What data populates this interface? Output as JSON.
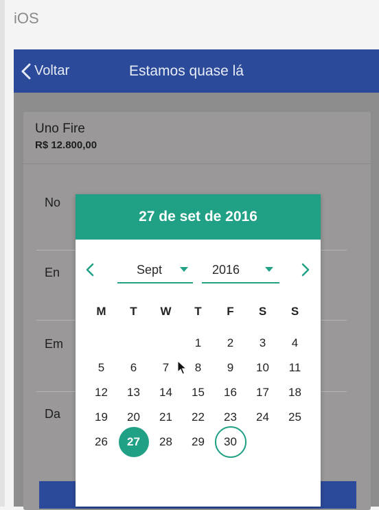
{
  "os_label": "iOS",
  "navbar": {
    "back_label": "Voltar",
    "title": "Estamos quase lá"
  },
  "product": {
    "name": "Uno Fire",
    "price": "R$ 12.800,00"
  },
  "form": {
    "fields": [
      {
        "label": "No"
      },
      {
        "label": "En"
      },
      {
        "label": "Em"
      },
      {
        "label": "Da"
      }
    ]
  },
  "datepicker": {
    "header": "27 de set de 2016",
    "month": "Sept",
    "year": "2016",
    "weekdays": [
      "M",
      "T",
      "W",
      "T",
      "F",
      "S",
      "S"
    ],
    "weeks": [
      [
        "",
        "",
        "",
        "1",
        "2",
        "3",
        "4"
      ],
      [
        "5",
        "6",
        "7",
        "8",
        "9",
        "10",
        "11"
      ],
      [
        "12",
        "13",
        "14",
        "15",
        "16",
        "17",
        "18"
      ],
      [
        "19",
        "20",
        "21",
        "22",
        "23",
        "24",
        "25"
      ],
      [
        "26",
        "27",
        "28",
        "29",
        "30",
        "",
        ""
      ]
    ],
    "selected_day": "27",
    "today_day": "30"
  },
  "colors": {
    "navbar": "#2b4a9a",
    "accent": "#20a084",
    "overlay": "#8e8d8d"
  }
}
